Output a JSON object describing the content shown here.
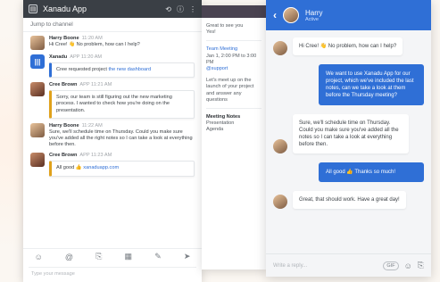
{
  "app": {
    "title": "Xanadu App",
    "channel_placeholder": "Jump to channel"
  },
  "left_feed": {
    "messages": [
      {
        "author": "Harry Boone",
        "time": "11:20 AM",
        "text": "Hi Cree! 👋 No problem, how can I help?"
      },
      {
        "author": "Xanadu",
        "time": "APP 11:20 AM",
        "card_text": "Cree requested project",
        "card_link": "the new dashboard",
        "card_kind": "blue"
      },
      {
        "author": "Cree Brown",
        "time": "APP 11:21 AM",
        "card_text": "Sorry, our team is still figuring out the new marketing process. I wanted to check how you're doing on the presentation.",
        "card_kind": "gold"
      },
      {
        "author": "Harry Boone",
        "time": "11:22 AM",
        "text": "Sure, we'll schedule time on Thursday. Could you make sure you've added all the right notes so I can take a look at everything before then."
      },
      {
        "author": "Cree Brown",
        "time": "APP 11:23 AM",
        "card_text": "All good 👍",
        "card_link": "xanaduapp.com",
        "card_kind": "gold"
      }
    ],
    "toolbar_icons": [
      "emoji-icon",
      "mention-icon",
      "attach-icon",
      "gif-icon",
      "format-icon",
      "send-icon"
    ],
    "input_placeholder": "Type your message"
  },
  "mid_feed": {
    "lines_top": [
      "Great to see you",
      "Yes!"
    ],
    "lines_meeting": [
      "Team Meeting",
      "Jan 1, 2:00 PM to 3:00 PM",
      "@support"
    ],
    "lines_bottom": [
      "Let's meet up on the launch of your project and answer any questions"
    ],
    "section_title": "Meeting Notes",
    "section_lines": [
      "Presentation",
      "Agenda"
    ]
  },
  "right_chat": {
    "contact_name": "Harry",
    "contact_status": "Active",
    "messages": [
      {
        "from": "in",
        "text": "Hi Cree! 👋 No problem, how can I help?"
      },
      {
        "from": "out",
        "text": "We want to use Xanadu App for our project, which we've included the last notes, can we take a look at them before the Thursday meeting?"
      },
      {
        "from": "in",
        "text": "Sure, we'll schedule time on Thursday. Could you make sure you've added all the notes so I can take a look at everything before then."
      },
      {
        "from": "out",
        "text": "All good 👍 Thanks so much!"
      },
      {
        "from": "in",
        "text": "Great, that should work. Have a great day!"
      }
    ],
    "input_placeholder": "Write a reply...",
    "gif_label": "GIF"
  }
}
